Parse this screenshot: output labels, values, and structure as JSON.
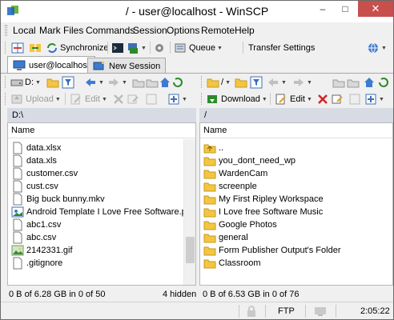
{
  "window": {
    "title": "/ - user@localhost - WinSCP",
    "minimize": "–",
    "maximize": "□",
    "close": "✕"
  },
  "menu": [
    "Local",
    "Mark",
    "Files",
    "Commands",
    "Session",
    "Options",
    "Remote",
    "Help"
  ],
  "toolbar": {
    "synchronize_label": "Synchronize",
    "queue_label": "Queue",
    "transfer_settings_label": "Transfer Settings"
  },
  "tabs": {
    "session": "user@localhost",
    "new_session": "New Session"
  },
  "local": {
    "drive": "D:",
    "upload_label": "Upload",
    "edit_label": "Edit",
    "path": "D:\\",
    "column_name": "Name",
    "files": [
      {
        "name": "data.xlsx",
        "icon": "file-icon"
      },
      {
        "name": "data.xls",
        "icon": "file-icon"
      },
      {
        "name": "customer.csv",
        "icon": "file-icon"
      },
      {
        "name": "cust.csv",
        "icon": "file-icon"
      },
      {
        "name": "Big buck bunny.mkv",
        "icon": "file-icon"
      },
      {
        "name": "Android Template I Love Free Software.pdn",
        "icon": "pdn-file-icon"
      },
      {
        "name": "abc1.csv",
        "icon": "file-icon"
      },
      {
        "name": "abc.csv",
        "icon": "file-icon"
      },
      {
        "name": "2142331.gif",
        "icon": "image-file-icon"
      },
      {
        "name": ".gitignore",
        "icon": "file-icon"
      }
    ],
    "status_left": "0 B of 6.28 GB in 0 of 50",
    "status_right": "4 hidden"
  },
  "remote": {
    "drive": "/",
    "download_label": "Download",
    "edit_label": "Edit",
    "path": "/",
    "column_name": "Name",
    "files": [
      {
        "name": "..",
        "icon": "parent-dir-icon"
      },
      {
        "name": "you_dont_need_wp",
        "icon": "folder-icon"
      },
      {
        "name": "WardenCam",
        "icon": "folder-icon"
      },
      {
        "name": "screenple",
        "icon": "folder-icon"
      },
      {
        "name": "My First Ripley Workspace",
        "icon": "folder-icon"
      },
      {
        "name": "I Love free Software Music",
        "icon": "folder-icon"
      },
      {
        "name": "Google Photos",
        "icon": "folder-icon"
      },
      {
        "name": "general",
        "icon": "folder-icon"
      },
      {
        "name": "Form Publisher Output's Folder",
        "icon": "folder-icon"
      },
      {
        "name": "Classroom",
        "icon": "folder-icon"
      }
    ],
    "status_left": "0 B of 6.53 GB in 0 of 76"
  },
  "statusbar": {
    "protocol": "FTP",
    "time": "2:05:22"
  },
  "colors": {
    "path_bar": "#d7dbe3",
    "folder": "#f3c543",
    "close_button": "#c7504d"
  }
}
